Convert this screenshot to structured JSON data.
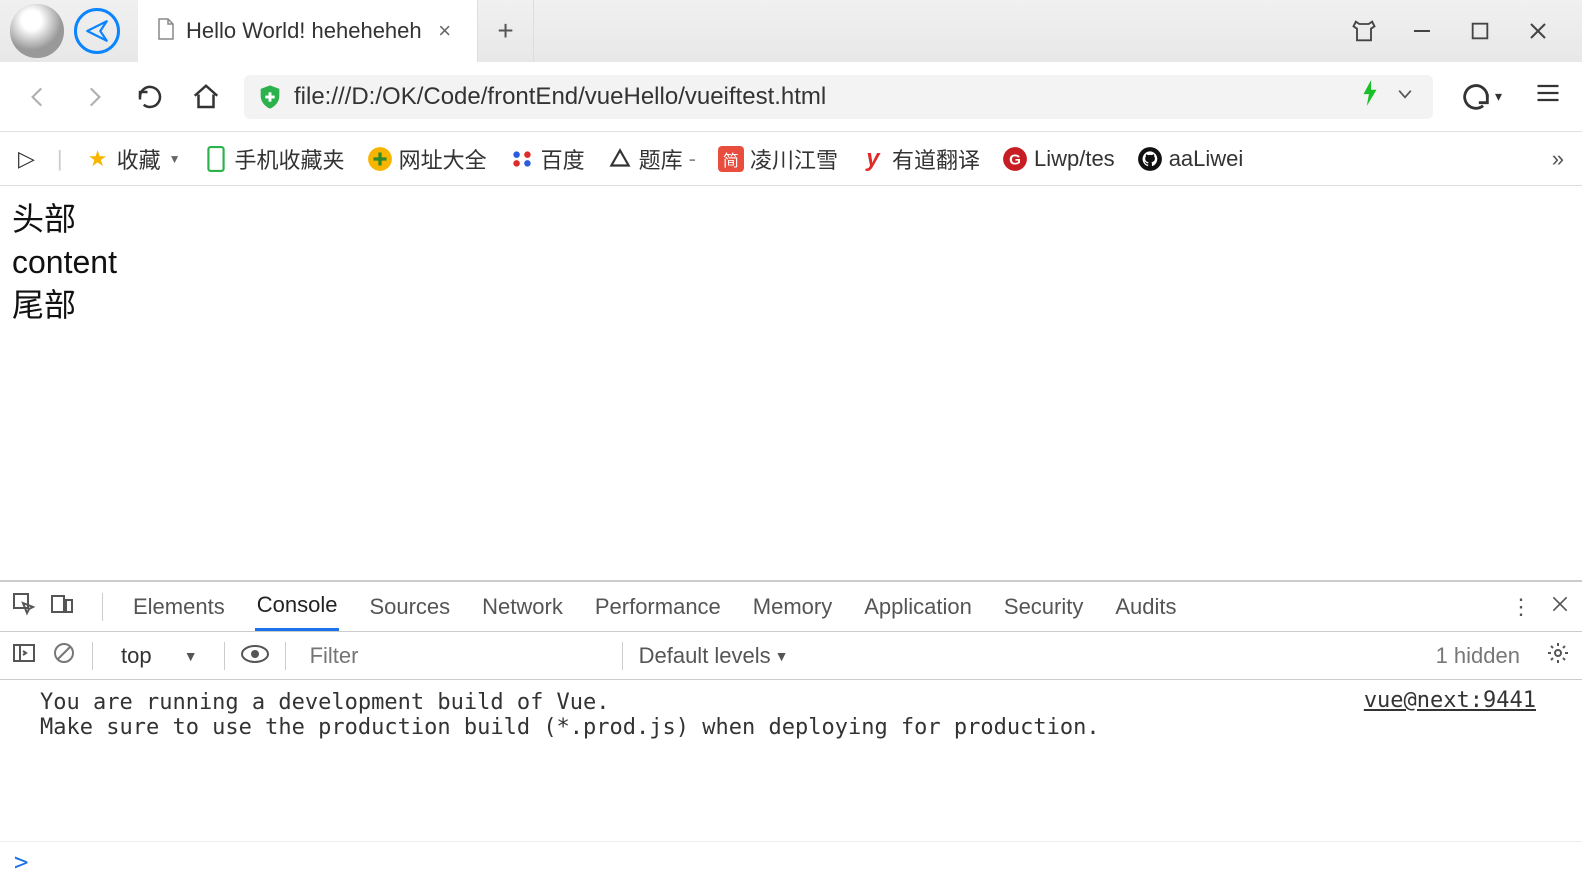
{
  "titlebar": {
    "tab_title": "Hello World! heheheheh",
    "close": "×",
    "newtab": "+"
  },
  "addressbar": {
    "url": "file:///D:/OK/Code/frontEnd/vueHello/vueiftest.html"
  },
  "bookmarks": {
    "panel": "▷",
    "fav": "收藏",
    "mobile": "手机收藏夹",
    "sites": "网址大全",
    "baidu": "百度",
    "tiku": "题库",
    "lcjx": "凌川江雪",
    "youdao": "有道翻译",
    "liwp": "Liwp/tes",
    "aaliwei": "aaLiwei",
    "more": "»"
  },
  "page": {
    "line1": "头部",
    "line2": "content",
    "line3": "尾部"
  },
  "devtools": {
    "tabs": {
      "elements": "Elements",
      "console": "Console",
      "sources": "Sources",
      "network": "Network",
      "performance": "Performance",
      "memory": "Memory",
      "application": "Application",
      "security": "Security",
      "audits": "Audits"
    },
    "top_select": "top",
    "filter_placeholder": "Filter",
    "levels": "Default levels",
    "hidden": "1 hidden",
    "console": {
      "line1": "You are running a development build of Vue.",
      "line2": "Make sure to use the production build (*.prod.js) when deploying for production.",
      "source": "vue@next:9441"
    },
    "prompt": ">"
  }
}
